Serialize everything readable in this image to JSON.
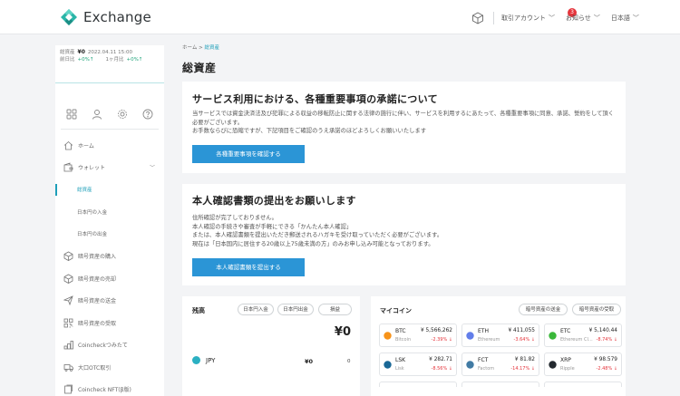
{
  "header": {
    "brand": "Exchange",
    "account_label": "取引アカウント",
    "notification_count": "3",
    "notices_label": "お知らせ",
    "language_label": "日本語"
  },
  "sidebar": {
    "summary": {
      "total_label": "総資産",
      "total_value": "¥0",
      "date": "2022.04.11 15:00",
      "change_label": "前日比",
      "change_value": "+0%↑",
      "prev_label": "1ヶ月比",
      "prev_value": "+0%↑"
    },
    "menu": [
      {
        "label": "ホーム"
      },
      {
        "label": "ウォレット"
      },
      {
        "label": "総資産"
      },
      {
        "label": "日本円の入金"
      },
      {
        "label": "日本円の出金"
      },
      {
        "label": "暗号資産の購入"
      },
      {
        "label": "暗号資産の売却"
      },
      {
        "label": "暗号資産の送金"
      },
      {
        "label": "暗号資産の受取"
      },
      {
        "label": "Coincheckつみたて"
      },
      {
        "label": "大口OTC取引"
      },
      {
        "label": "Coincheck NFT(β版)"
      }
    ]
  },
  "breadcrumb": {
    "home": "ホーム",
    "sep": ">",
    "current": "総資産"
  },
  "page_title": "総資産",
  "notice_card": {
    "title": "サービス利用における、各種重要事項の承諾について",
    "body": "当サービスでは資金決済法及び犯罪による収益の移転防止に関する法律の施行に伴い、サービスを利用するにあたって、各種重要事項に同意、承諾、誓約をして頂く必要がございます。",
    "body2": "お手数ならびに恐縮ですが、下記項目をご確認のうえ承諾のほどよろしくお願いいたします",
    "button": "各種重要事項を確認する"
  },
  "kyc_card": {
    "title": "本人確認書類の提出をお願いします",
    "lines": [
      "住所確認が完了しておりません。",
      "本人確認の手続きや審査が手軽にできる「かんたん本人確認」",
      "または、本人確認書類を提出いただき郵送されるハガキを受け取っていただく必要がございます。",
      "現在は「日本国内に居住する20歳以上75歳未満の方」のみお申し込み可能となっております。"
    ],
    "button": "本人確認書類を提出する"
  },
  "balance_card": {
    "title": "残高",
    "deposit": "日本円入金",
    "withdraw": "日本円出金",
    "history": "損益",
    "total": "¥0",
    "currency": "JPY",
    "amount": "¥0",
    "qty": "0"
  },
  "coins_card": {
    "title": "マイコイン",
    "send": "暗号資産の送金",
    "receive": "暗号資産の受取",
    "coins": [
      {
        "symbol": "BTC",
        "name": "Bitcoin",
        "price": "¥ 5,566,262",
        "change": "-2.39% ↓",
        "color": "#f7931a"
      },
      {
        "symbol": "ETH",
        "name": "Ethereum",
        "price": "¥ 411,055",
        "change": "-3.64% ↓",
        "color": "#627eea"
      },
      {
        "symbol": "ETC",
        "name": "Ethereum Cl...",
        "price": "¥ 5,140.44",
        "change": "-8.74% ↓",
        "color": "#3ab83a"
      },
      {
        "symbol": "LSK",
        "name": "Lisk",
        "price": "¥ 282.71",
        "change": "-8.56% ↓",
        "color": "#1a6896"
      },
      {
        "symbol": "FCT",
        "name": "Factom",
        "price": "¥ 81.82",
        "change": "-14.17% ↓",
        "color": "#417ba4"
      },
      {
        "symbol": "XRP",
        "name": "Ripple",
        "price": "¥ 98.579",
        "change": "-2.48% ↓",
        "color": "#23292f"
      }
    ]
  }
}
